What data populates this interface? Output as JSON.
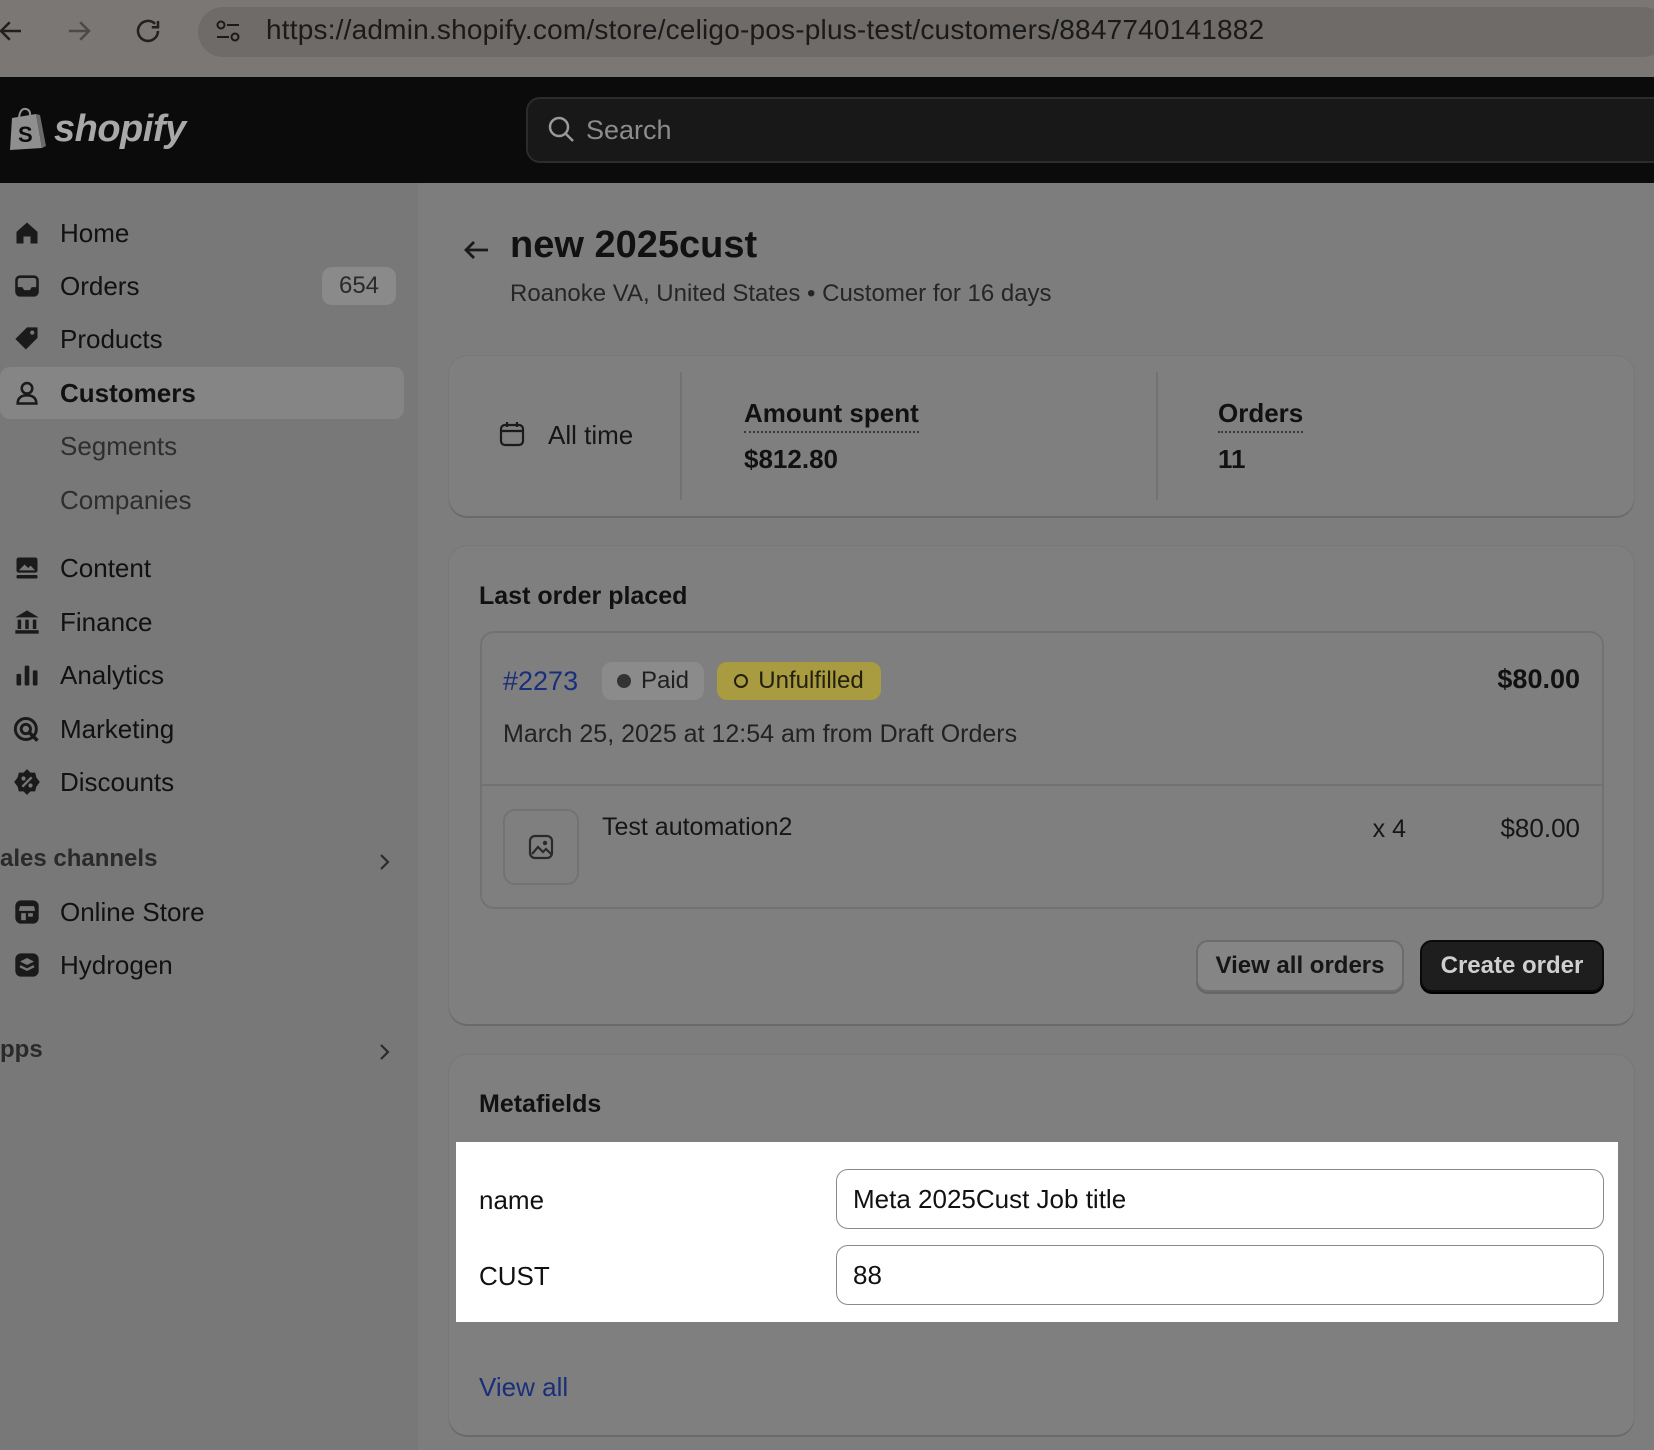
{
  "browser": {
    "url": "https://admin.shopify.com/store/celigo-pos-plus-test/customers/8847740141882"
  },
  "topbar": {
    "logo_text": "shopify",
    "search_placeholder": "Search"
  },
  "sidebar": {
    "items": [
      {
        "label": "Home",
        "icon": "home-icon"
      },
      {
        "label": "Orders",
        "icon": "orders-icon",
        "badge": "654"
      },
      {
        "label": "Products",
        "icon": "tag-icon"
      },
      {
        "label": "Customers",
        "icon": "person-icon",
        "active": true
      },
      {
        "label": "Segments",
        "sub": true
      },
      {
        "label": "Companies",
        "sub": true
      },
      {
        "label": "Content",
        "icon": "content-icon"
      },
      {
        "label": "Finance",
        "icon": "bank-icon"
      },
      {
        "label": "Analytics",
        "icon": "bar-chart-icon"
      },
      {
        "label": "Marketing",
        "icon": "target-icon"
      },
      {
        "label": "Discounts",
        "icon": "discount-icon"
      }
    ],
    "sales_channels_heading": "ales channels",
    "channels": [
      {
        "label": "Online Store",
        "icon": "store-icon"
      },
      {
        "label": "Hydrogen",
        "icon": "hydrogen-icon"
      }
    ],
    "apps_heading": "pps"
  },
  "customer": {
    "name": "new 2025cust",
    "subtitle": "Roanoke VA, United States • Customer for 16 days"
  },
  "stats": {
    "period": "All time",
    "amount_label": "Amount spent",
    "amount_value": "$812.80",
    "orders_label": "Orders",
    "orders_value": "11"
  },
  "last_order": {
    "heading": "Last order placed",
    "number": "#2273",
    "payment_status": "Paid",
    "fulfillment_status": "Unfulfilled",
    "total": "$80.00",
    "meta": "March 25, 2025 at 12:54 am from Draft Orders",
    "item_name": "Test automation2",
    "item_qty": "x 4",
    "item_price": "$80.00",
    "view_all_label": "View all orders",
    "create_label": "Create order"
  },
  "metafields": {
    "heading": "Metafields",
    "fields": [
      {
        "label": "name",
        "value": "Meta 2025Cust Job title"
      },
      {
        "label": "CUST",
        "value": "88"
      }
    ],
    "view_all": "View all"
  }
}
